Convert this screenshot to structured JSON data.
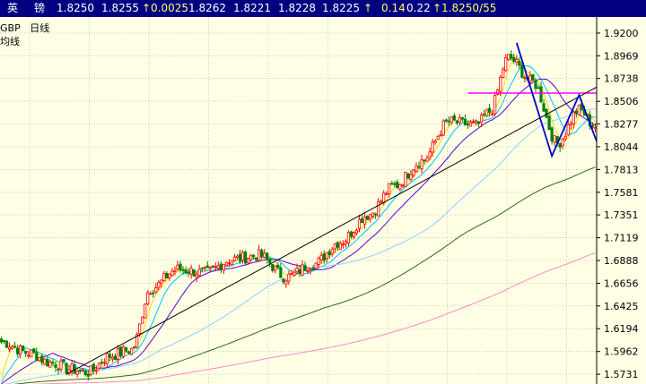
{
  "header": {
    "name_1": "英",
    "name_2": "镑",
    "last": "1.8250",
    "ask": "1.8255",
    "change": "↑0.0025",
    "high": "1.8262",
    "low": "1.8221",
    "prev": "1.8228",
    "open": "1.8225",
    "arrow": "↑",
    "pct": "0.14",
    "amp": "0.22",
    "volume": "↑1.8250/55"
  },
  "labels": {
    "symbol": "GBP",
    "period": "日线",
    "indicator": "均线"
  },
  "colors": {
    "background": "#ffffe6",
    "up": "#ff0000",
    "down": "#008000",
    "ma1": "#ffd700",
    "ma2": "#00bfff",
    "ma3": "#5a00d8",
    "ma4": "#90d0ff",
    "ma5": "#2e6b1a",
    "ma6": "#ff88cc",
    "resistance": "#ff00ff",
    "arrows": "#0000cc"
  },
  "chart_data": {
    "type": "candlestick",
    "period": "daily",
    "ylim": [
      1.565,
      1.9345
    ],
    "y_ticks": [
      "1.9200",
      "1.8969",
      "1.8738",
      "1.8506",
      "1.8277",
      "1.8044",
      "1.7813",
      "1.7581",
      "1.7351",
      "1.7119",
      "1.6888",
      "1.6656",
      "1.6425",
      "1.6194",
      "1.5962",
      "1.5731"
    ],
    "candle_count": 220,
    "path_control": [
      [
        0,
        1.606
      ],
      [
        10,
        1.595
      ],
      [
        18,
        1.585
      ],
      [
        26,
        1.578
      ],
      [
        32,
        1.575
      ],
      [
        40,
        1.592
      ],
      [
        48,
        1.598
      ],
      [
        55,
        1.66
      ],
      [
        65,
        1.68
      ],
      [
        75,
        1.676
      ],
      [
        85,
        1.69
      ],
      [
        95,
        1.694
      ],
      [
        105,
        1.672
      ],
      [
        115,
        1.685
      ],
      [
        125,
        1.708
      ],
      [
        135,
        1.735
      ],
      [
        145,
        1.765
      ],
      [
        155,
        1.79
      ],
      [
        165,
        1.83
      ],
      [
        175,
        1.826
      ],
      [
        180,
        1.84
      ],
      [
        187,
        1.895
      ],
      [
        196,
        1.87
      ],
      [
        205,
        1.808
      ],
      [
        213,
        1.842
      ],
      [
        219,
        1.825
      ]
    ],
    "moving_average_periods": [
      5,
      10,
      20,
      60,
      120,
      250
    ],
    "resistance_level": 1.859,
    "trendline": [
      [
        24,
        1.573
      ],
      [
        219,
        1.865
      ]
    ],
    "projection_path": [
      [
        190,
        1.91
      ],
      [
        203,
        1.795
      ],
      [
        213,
        1.857
      ],
      [
        225,
        1.77
      ]
    ]
  }
}
